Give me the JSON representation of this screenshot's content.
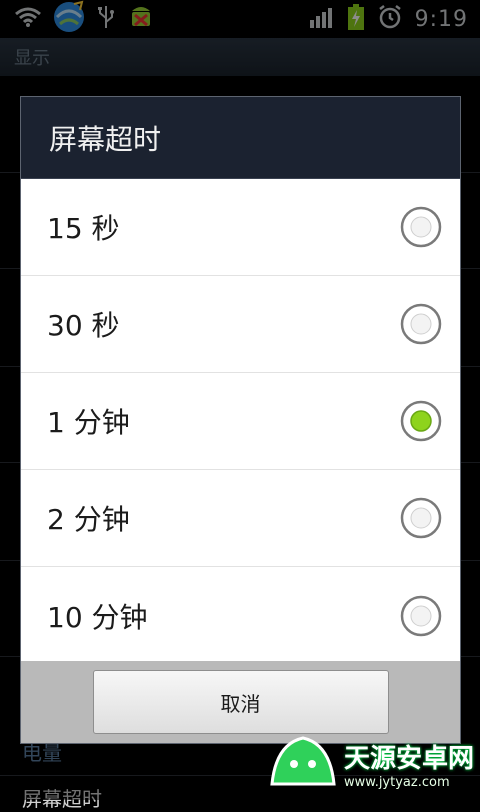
{
  "status_bar": {
    "time": "9:19",
    "icons": [
      "wifi-icon",
      "globe-sync-icon",
      "usb-icon",
      "android-debug-icon",
      "signal-icon",
      "battery-charging-icon",
      "alarm-icon"
    ]
  },
  "background": {
    "header_title": "显示",
    "partial_item_1": "电量",
    "partial_item_2": "屏幕超时"
  },
  "dialog": {
    "title": "屏幕超时",
    "options": [
      {
        "label": "15 秒",
        "selected": false
      },
      {
        "label": "30 秒",
        "selected": false
      },
      {
        "label": "1 分钟",
        "selected": true
      },
      {
        "label": "2 分钟",
        "selected": false
      },
      {
        "label": "10 分钟",
        "selected": false
      }
    ],
    "cancel_label": "取消"
  },
  "watermark": {
    "title": "天源安卓网",
    "url": "www.jytyaz.com"
  },
  "colors": {
    "accent_selected": "#8ed31c",
    "dialog_header": "#1b2230",
    "button_bar": "#b9b9b9"
  }
}
